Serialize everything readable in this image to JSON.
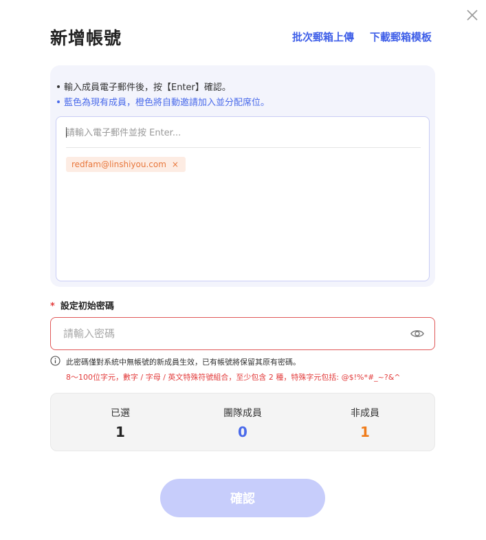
{
  "dialog": {
    "title": "新增帳號",
    "batch_upload_label": "批次郵箱上傳",
    "download_template_label": "下載郵箱模板"
  },
  "email_section": {
    "hint1": "輸入成員電子郵件後，按【Enter】確認。",
    "hint2": "藍色為現有成員，橙色將自動邀請加入並分配席位。",
    "input_placeholder": "請輸入電子郵件並按 Enter...",
    "tags": [
      {
        "email": "redfam@linshiyou.com",
        "remove": "×",
        "color": "#e8773c"
      }
    ]
  },
  "password": {
    "required_mark": "*",
    "label": "設定初始密碼",
    "placeholder": "請輸入密碼",
    "note": "此密碼僅對系統中無帳號的新成員生效，已有帳號將保留其原有密碼。",
    "rule": "8～100位字元，數字 / 字母 / 英文特殊符號組合，至少包含 2 種，特殊字元包括: @$!%*#_~?&^"
  },
  "stats": [
    {
      "label": "已選",
      "value": "1",
      "color": "#222222"
    },
    {
      "label": "團隊成員",
      "value": "0",
      "color": "#4a6aea"
    },
    {
      "label": "非成員",
      "value": "1",
      "color": "#f07c1a"
    }
  ],
  "confirm_label": "確認",
  "icons": {
    "close": "close-icon",
    "eye": "eye-icon",
    "info": "info-icon",
    "tag_remove": "close-icon"
  },
  "colors": {
    "accent": "#3f5fe8",
    "warning": "#e23b3b",
    "orange": "#e8773c",
    "button_disabled": "#c7cdfb"
  }
}
